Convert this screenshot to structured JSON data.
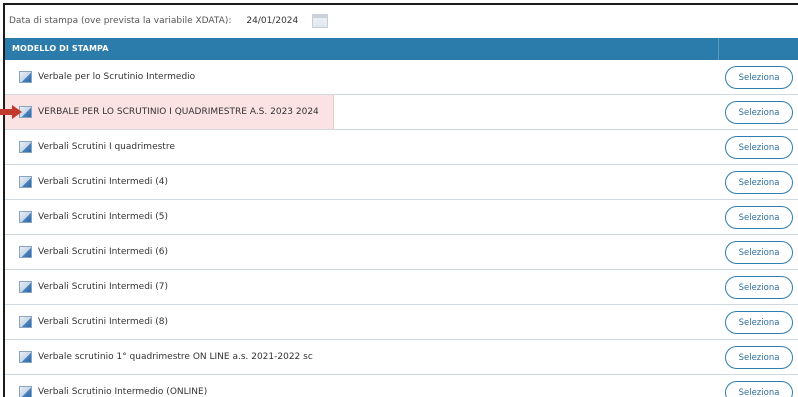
{
  "date_bar": {
    "label": "Data di stampa (ove prevista la variabile XDATA):",
    "value": "24/01/2024"
  },
  "table": {
    "header": "MODELLO DI STAMPA",
    "select_label": "Seleziona",
    "rows": [
      {
        "label": "Verbale per lo Scrutinio Intermedio"
      },
      {
        "label": "VERBALE PER LO SCRUTINIO I QUADRIMESTRE A.S. 2023 2024"
      },
      {
        "label": "Verbali Scrutini I quadrimestre"
      },
      {
        "label": "Verbali Scrutini Intermedi (4)"
      },
      {
        "label": "Verbali Scrutini Intermedi (5)"
      },
      {
        "label": "Verbali Scrutini Intermedi (6)"
      },
      {
        "label": "Verbali Scrutini Intermedi (7)"
      },
      {
        "label": "Verbali Scrutini Intermedi (8)"
      },
      {
        "label": "Verbale scrutinio 1° quadrimestre ON LINE a.s. 2021-2022 sc"
      },
      {
        "label": "Verbali Scrutinio Intermedio (ONLINE)"
      }
    ]
  },
  "colors": {
    "header_bg": "#2b7bab",
    "highlight_bg": "#fbe3e3",
    "arrow": "#c0392b",
    "button_border": "#2f7eb0"
  }
}
